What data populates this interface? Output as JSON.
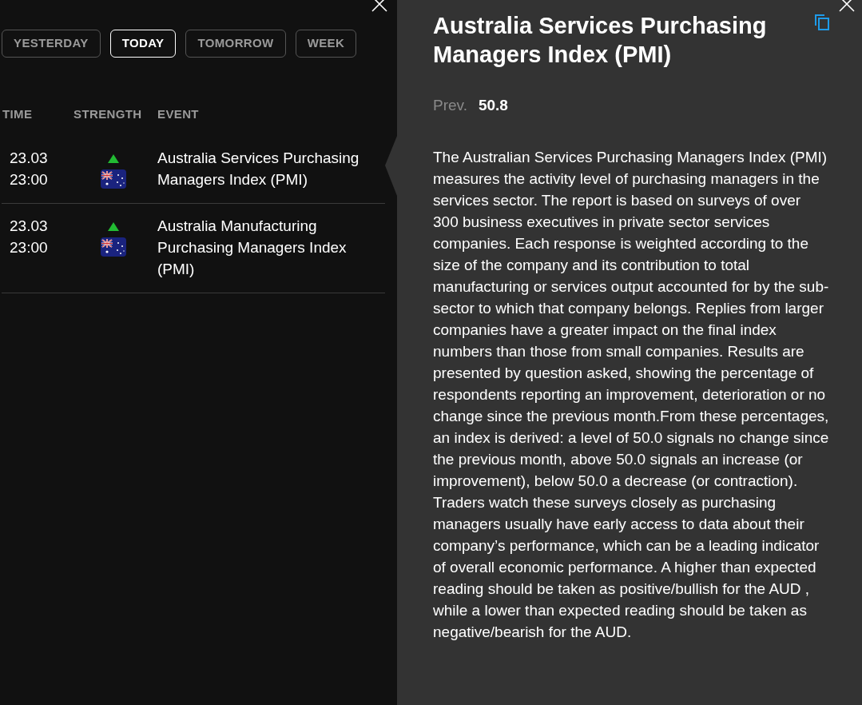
{
  "tabs": [
    {
      "label": "YESTERDAY",
      "selected": false
    },
    {
      "label": "TODAY",
      "selected": true
    },
    {
      "label": "TOMORROW",
      "selected": false
    },
    {
      "label": "WEEK",
      "selected": false
    }
  ],
  "table": {
    "columns": [
      "TIME",
      "STRENGTH",
      "EVENT"
    ],
    "rows": [
      {
        "date": "23.03",
        "time": "23:00",
        "event": "Australia Services Purchasing Managers Index (PMI)",
        "selected": true
      },
      {
        "date": "23.03",
        "time": "23:00",
        "event": "Australia Manufacturing Purchasing Managers Index (PMI)",
        "selected": false
      }
    ]
  },
  "detail": {
    "title": "Australia Services Purchasing Managers Index (PMI)",
    "prev_label": "Prev.",
    "prev_value": "50.8",
    "description": "The Australian Services Purchasing Managers Index (PMI) measures the activity level of purchasing managers in the services sector. The report is based on surveys of over 300 business executives in private sector services companies. Each response is weighted according to the size of the company and its contribution to total manufacturing or services output accounted for by the sub-sector to which that company belongs. Replies from larger companies have a greater impact on the final index numbers than those from small companies. Results are presented by question asked, showing the percentage of respondents reporting an improvement, deterioration or no change since the previous month.From these percentages, an index is derived: a level of 50.0 signals no change since the previous month, above 50.0 signals an increase (or improvement), below 50.0 a decrease (or contraction). Traders watch these surveys closely as purchasing managers usually have early access to data about their company’s performance, which can be a leading indicator of overall economic performance. A higher than expected reading should be taken as positive/bullish for the AUD , while a lower than expected reading should be taken as negative/bearish for the AUD."
  }
}
